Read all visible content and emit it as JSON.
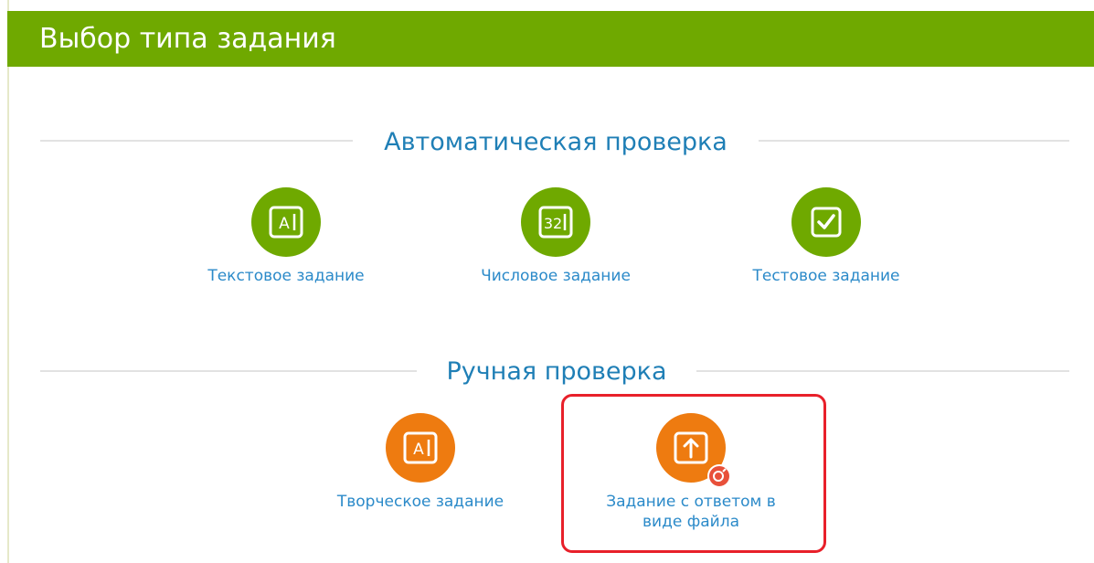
{
  "header": {
    "title": "Выбор типа задания"
  },
  "sections": {
    "auto": {
      "title": "Автоматическая проверка",
      "items": [
        {
          "label": "Текстовое задание",
          "icon": "text-answer-icon"
        },
        {
          "label": "Числовое задание",
          "icon": "number-answer-icon"
        },
        {
          "label": "Тестовое задание",
          "icon": "checkbox-icon"
        }
      ]
    },
    "manual": {
      "title": "Ручная проверка",
      "items": [
        {
          "label": "Творческое задание",
          "icon": "text-answer-icon"
        },
        {
          "label": "Задание с ответом в виде файла",
          "icon": "upload-icon",
          "badge_icon": "premium-badge-icon"
        }
      ]
    }
  },
  "colors": {
    "header": "#6fa900",
    "auto_circle": "#6fa900",
    "manual_circle": "#ee7b10",
    "label": "#2b8ac9",
    "section_title": "#1f7fb6",
    "highlight": "#e8202a"
  }
}
